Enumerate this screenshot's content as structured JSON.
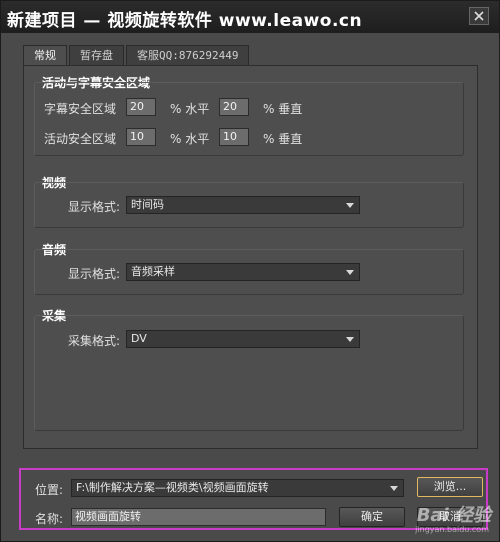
{
  "window": {
    "title": "新建项目 — 视频旋转软件 www.leawo.cn"
  },
  "tabs": [
    {
      "label": "常规",
      "active": true
    },
    {
      "label": "暂存盘",
      "active": false
    },
    {
      "label": "客服QQ:876292449",
      "active": false
    }
  ],
  "safe_area": {
    "title": "活动与字幕安全区域",
    "title_safe": {
      "label": "字幕安全区域",
      "h": "20",
      "h_unit": "% 水平",
      "v": "20",
      "v_unit": "% 垂直"
    },
    "action_safe": {
      "label": "活动安全区域",
      "h": "10",
      "h_unit": "% 水平",
      "v": "10",
      "v_unit": "% 垂直"
    }
  },
  "video": {
    "title": "视频",
    "display_label": "显示格式:",
    "display_value": "时间码"
  },
  "audio": {
    "title": "音频",
    "display_label": "显示格式:",
    "display_value": "音频采样"
  },
  "capture": {
    "title": "采集",
    "format_label": "采集格式:",
    "format_value": "DV"
  },
  "location": {
    "label": "位置:",
    "value": "F:\\制作解决方案—视频类\\视频画面旋转",
    "browse_label": "浏览..."
  },
  "name": {
    "label": "名称:",
    "value": "视频画面旋转"
  },
  "buttons": {
    "ok": "确定",
    "cancel": "取消"
  },
  "watermark": {
    "brand": "Bai 经验",
    "url": "jingyan.baidu.com"
  },
  "colors": {
    "highlight_border": "#c83cc8",
    "focus_border": "#e0b860"
  }
}
